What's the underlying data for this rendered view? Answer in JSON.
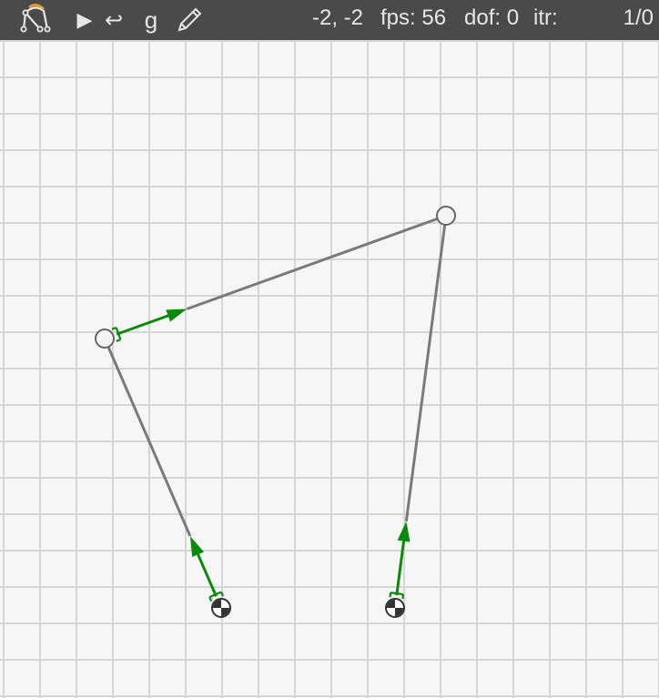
{
  "toolbar": {
    "logo_icon": "linkage-logo-icon",
    "run_icon": "play-icon",
    "run_glyph": "▶",
    "undo_icon": "undo-icon",
    "undo_glyph": "↩",
    "gravity_label": "g",
    "pencil_icon": "pencil-icon",
    "coords": "-2, -2",
    "fps": "fps: 56",
    "dof": "dof: 0",
    "itr": "itr:",
    "counter": "1/0"
  },
  "colors": {
    "toolbar_bg": "#4a4a4a",
    "toolbar_text": "#e6e6e6",
    "grid_bg": "#f6f6f6",
    "grid_line": "#d6d6d6",
    "link": "#7a7a7a",
    "drive": "#0a8a0a",
    "node_fill": "#f4f4f4",
    "node_stroke": "#666666",
    "logo_accent": "#f0a020"
  },
  "model": {
    "nodes": [
      {
        "id": "A0",
        "type": "base"
      },
      {
        "id": "B0",
        "type": "base"
      },
      {
        "id": "A",
        "type": "joint"
      },
      {
        "id": "B",
        "type": "joint"
      }
    ],
    "links": [
      {
        "from": "A0",
        "to": "A",
        "drive": true
      },
      {
        "from": "A",
        "to": "B",
        "drive": true
      },
      {
        "from": "B",
        "to": "B0",
        "drive": false
      },
      {
        "from": "B0",
        "to": "B",
        "drive": true
      }
    ]
  }
}
